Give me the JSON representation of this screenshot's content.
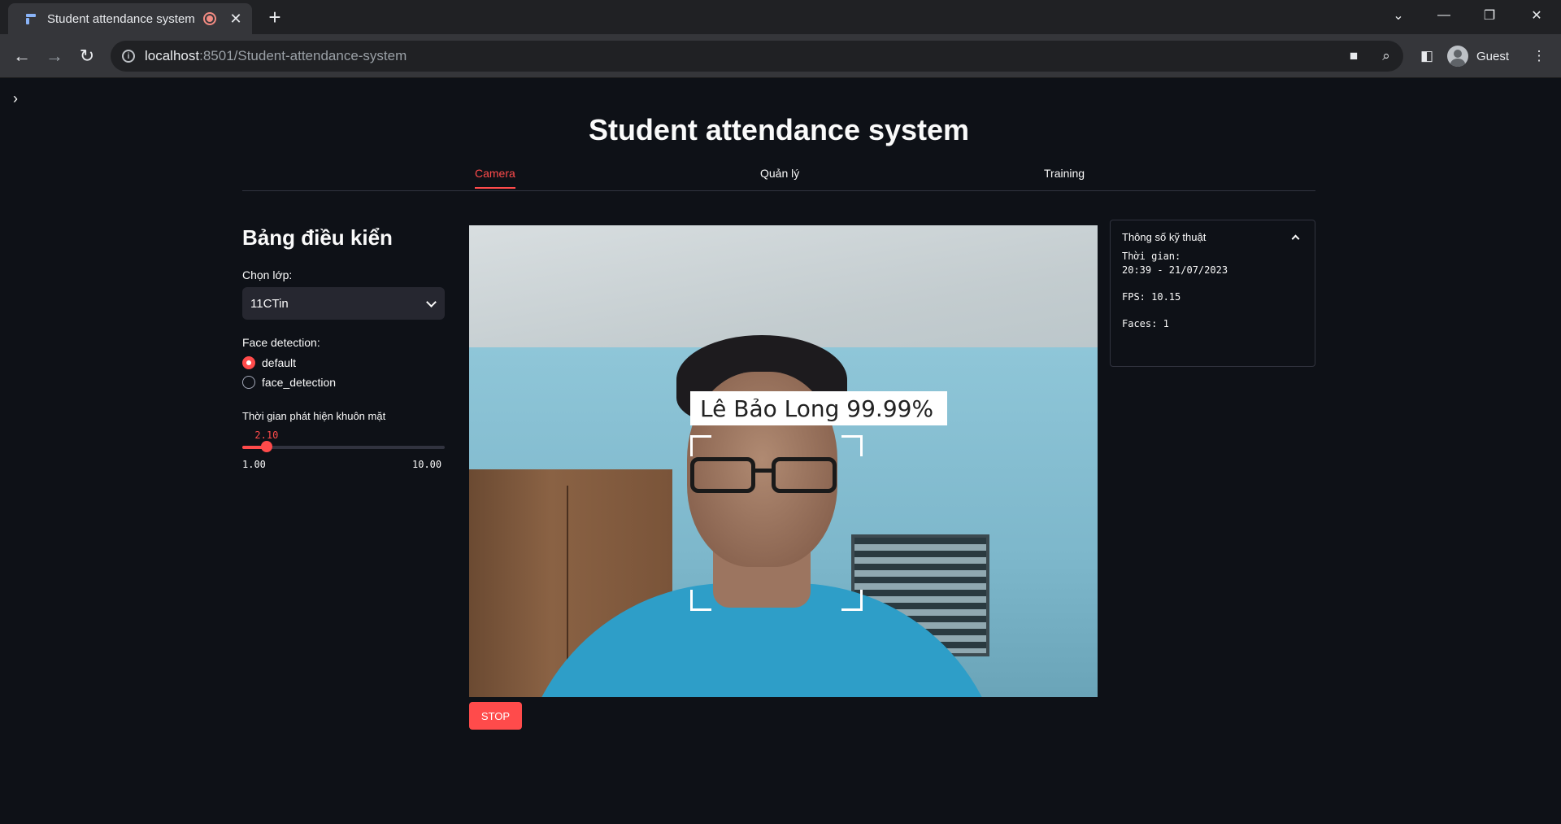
{
  "browser": {
    "tab_title": "Student attendance system",
    "url_host": "localhost",
    "url_rest": ":8501/Student-attendance-system",
    "profile_label": "Guest"
  },
  "app": {
    "title": "Student attendance system",
    "tabs": [
      {
        "label": "Camera",
        "active": true
      },
      {
        "label": "Quản lý",
        "active": false
      },
      {
        "label": "Training",
        "active": false
      }
    ]
  },
  "control_panel": {
    "title": "Bảng điều kiển",
    "class_select": {
      "label": "Chọn lớp:",
      "value": "11CTin"
    },
    "face_detection": {
      "label": "Face detection:",
      "options": [
        "default",
        "face_detection"
      ],
      "selected": "default"
    },
    "slider": {
      "label": "Thời gian phát hiện khuôn mặt",
      "value": "2.10",
      "min": "1.00",
      "max": "10.00",
      "numeric_value": 2.1,
      "numeric_min": 1.0,
      "numeric_max": 10.0
    }
  },
  "camera": {
    "face_label": "Lê Bảo Long 99.99%",
    "stop_label": "STOP"
  },
  "tech_info": {
    "title": "Thông số kỹ thuật",
    "time_label": "Thời gian:",
    "time_value": "20:39 - 21/07/2023",
    "fps": "FPS: 10.15",
    "faces": "Faces: 1"
  },
  "colors": {
    "accent": "#ff4b4b",
    "background": "#0e1117",
    "widget_bg": "#262730"
  }
}
